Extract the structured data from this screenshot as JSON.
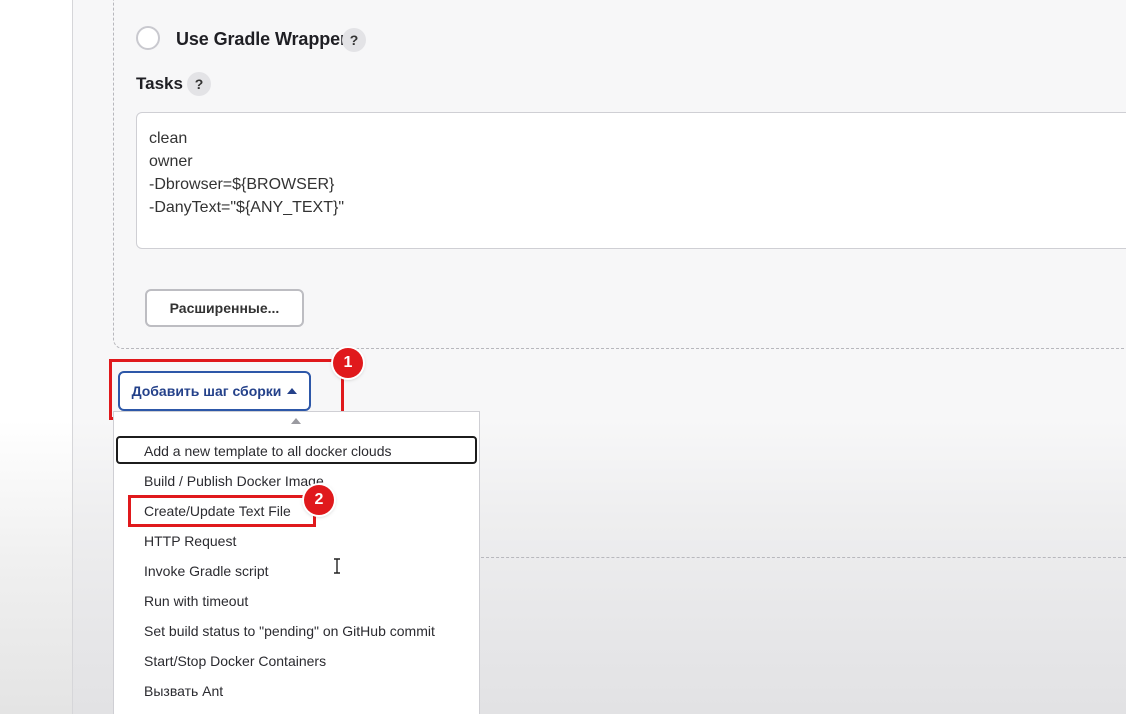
{
  "gradle": {
    "use_wrapper_label": "Use Gradle Wrapper",
    "help_glyph": "?",
    "tasks_label": "Tasks",
    "tasks_value": "clean\nowner\n-Dbrowser=${BROWSER}\n-DanyText=\"${ANY_TEXT}\""
  },
  "buttons": {
    "advanced_label": "Расширенные...",
    "add_step_label": "Добавить шаг сборки"
  },
  "annotations": {
    "marker_1": "1",
    "marker_2": "2",
    "highlight_color": "#e0191c"
  },
  "dropdown": {
    "items": [
      "Add a new template to all docker clouds",
      "Build / Publish Docker Image",
      "Create/Update Text File",
      "HTTP Request",
      "Invoke Gradle script",
      "Run with timeout",
      "Set build status to \"pending\" on GitHub commit",
      "Start/Stop Docker Containers",
      "Вызвать Ant"
    ]
  },
  "colors": {
    "accent": "#2d57a8",
    "text": "#2b2b30"
  }
}
